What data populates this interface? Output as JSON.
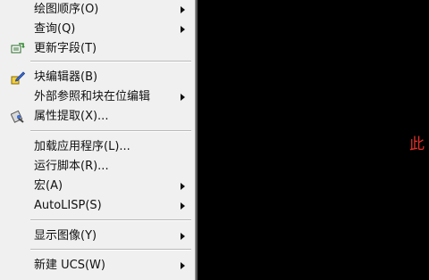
{
  "canvas": {
    "text_fragment": "此"
  },
  "menu": {
    "items": [
      {
        "label": "绘图顺序(O)",
        "submenu": true
      },
      {
        "label": "查询(Q)",
        "submenu": true
      },
      {
        "label": "更新字段(T)",
        "submenu": false,
        "icon": "update-fields-icon"
      },
      {
        "label": "块编辑器(B)",
        "submenu": false,
        "icon": "block-editor-icon"
      },
      {
        "label": "外部参照和块在位编辑",
        "submenu": true
      },
      {
        "label": "属性提取(X)...",
        "submenu": false,
        "icon": "attribute-extract-icon"
      },
      {
        "label": "加载应用程序(L)...",
        "submenu": false
      },
      {
        "label": "运行脚本(R)...",
        "submenu": false
      },
      {
        "label": "宏(A)",
        "submenu": true
      },
      {
        "label": "AutoLISP(S)",
        "submenu": true
      },
      {
        "label": "显示图像(Y)",
        "submenu": true
      },
      {
        "label": "新建 UCS(W)",
        "submenu": true
      }
    ]
  },
  "colors": {
    "menu_bg": "#f0f0f0",
    "canvas_bg": "#000000",
    "canvas_text": "#e0302a"
  }
}
